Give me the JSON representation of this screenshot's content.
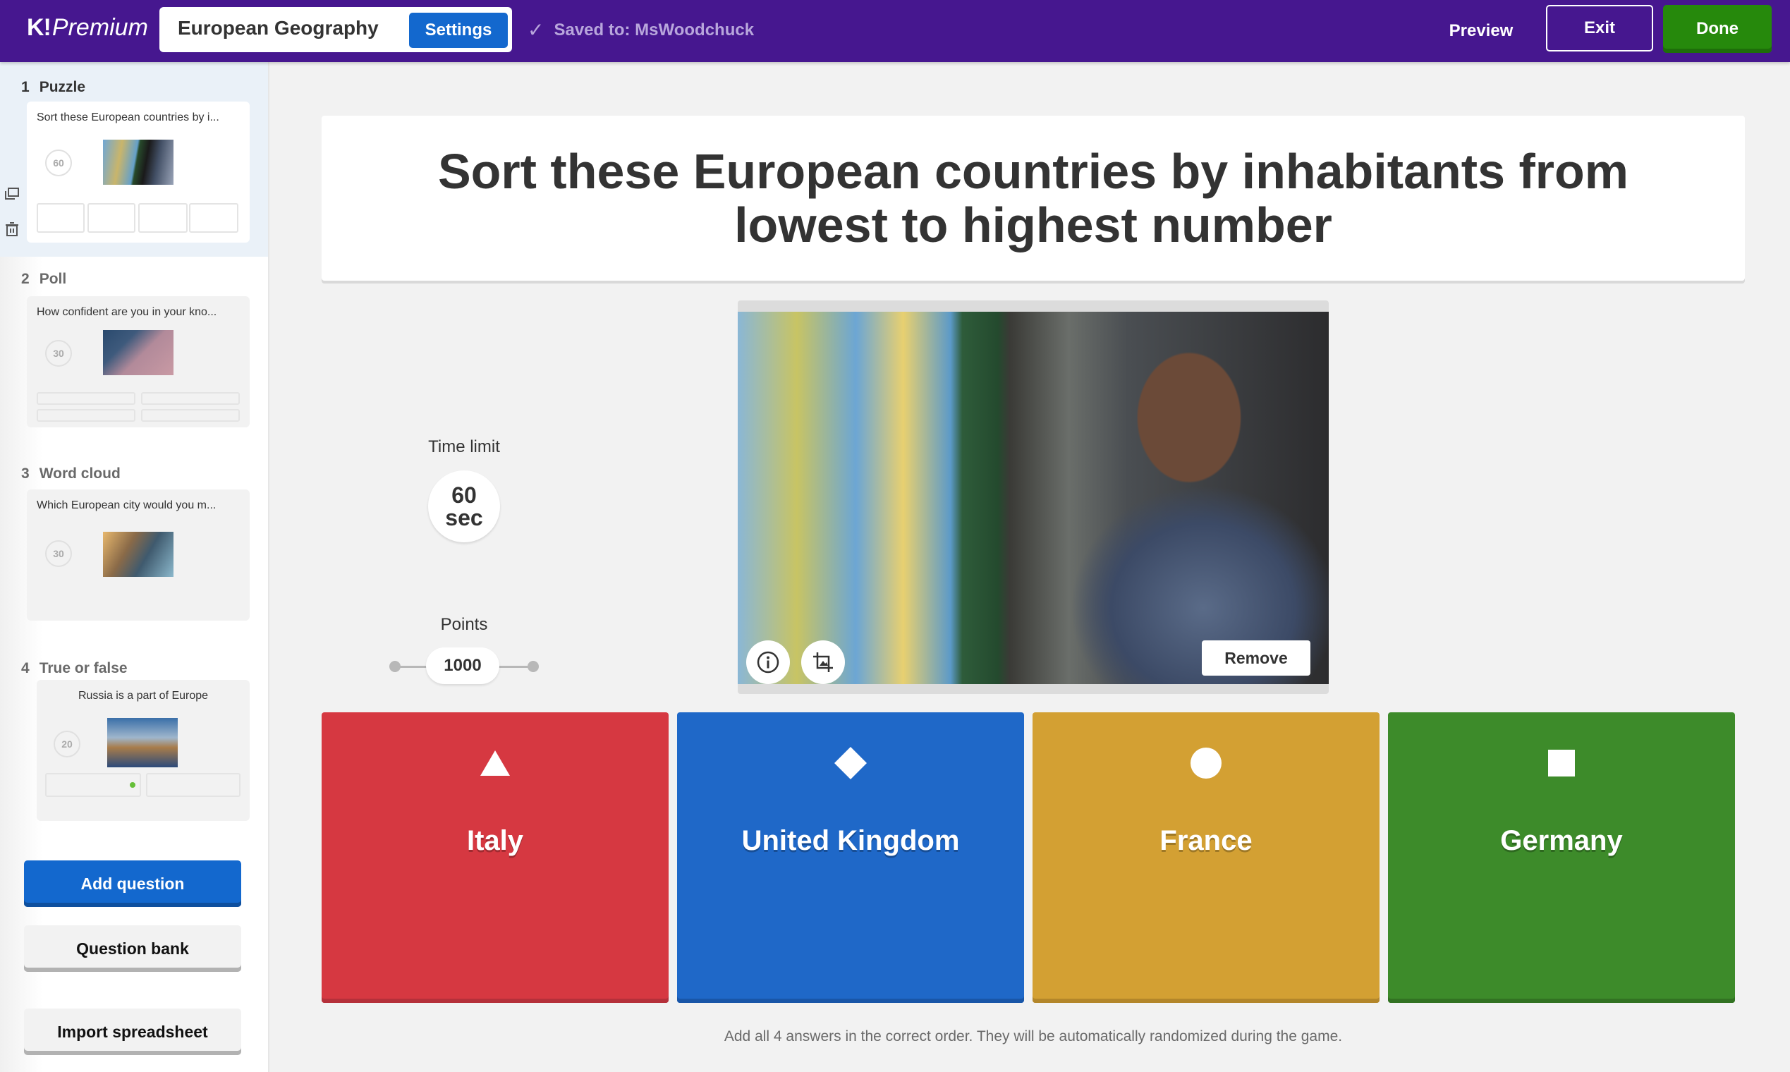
{
  "header": {
    "logo_k": "K!",
    "logo_premium": "Premium",
    "kahoot_title": "European Geography",
    "settings_label": "Settings",
    "saved_text": "Saved to: MsWoodchuck",
    "preview_label": "Preview",
    "exit_label": "Exit",
    "done_label": "Done"
  },
  "sidebar": {
    "questions": [
      {
        "number": "1",
        "type": "Puzzle",
        "text": "Sort these European countries by i...",
        "time": "60",
        "selected": true
      },
      {
        "number": "2",
        "type": "Poll",
        "text": "How confident are you in your kno...",
        "time": "30",
        "selected": false
      },
      {
        "number": "3",
        "type": "Word cloud",
        "text": "Which European city would you m...",
        "time": "30",
        "selected": false
      },
      {
        "number": "4",
        "type": "True or false",
        "text": "Russia is a part of Europe",
        "time": "20",
        "selected": false
      }
    ],
    "add_question_label": "Add question",
    "question_bank_label": "Question bank",
    "import_label": "Import spreadsheet"
  },
  "main": {
    "question": "Sort these European countries by inhabitants from lowest to highest number",
    "time_limit_label": "Time limit",
    "time_limit_value": "60",
    "time_limit_unit": "sec",
    "points_label": "Points",
    "points_value": "1000",
    "remove_label": "Remove",
    "answers": [
      {
        "shape": "triangle",
        "text": "Italy",
        "color": "#d63841"
      },
      {
        "shape": "diamond",
        "text": "United Kingdom",
        "color": "#1f68c8"
      },
      {
        "shape": "circle",
        "text": "France",
        "color": "#d3a033"
      },
      {
        "shape": "square",
        "text": "Germany",
        "color": "#3d8b2a"
      }
    ],
    "hint": "Add all 4 answers in the correct order. They will be automatically randomized during the game."
  },
  "colors": {
    "header_bg": "#46178f",
    "accent_blue": "#1368ce",
    "done_green": "#26890c"
  }
}
